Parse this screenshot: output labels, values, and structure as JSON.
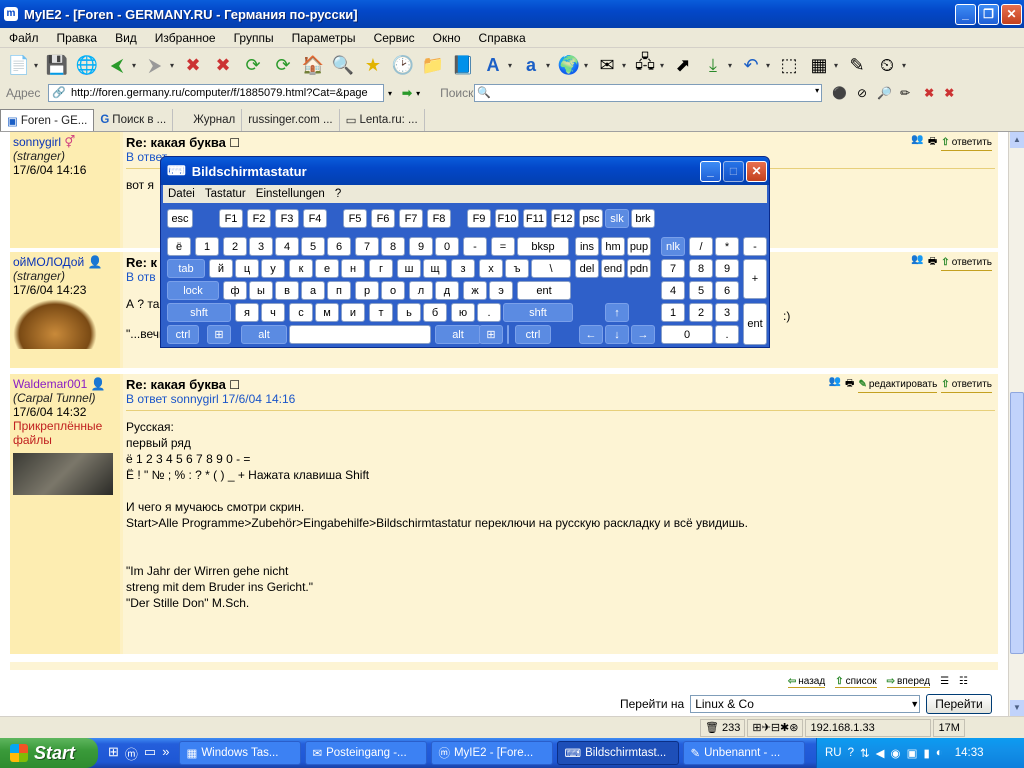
{
  "window": {
    "title": "MyIE2 - [Foren - GERMANY.RU - Германия по-русски]",
    "icon_name": "myie-icon"
  },
  "menu": [
    "Файл",
    "Правка",
    "Вид",
    "Избранное",
    "Группы",
    "Параметры",
    "Сервис",
    "Окно",
    "Справка"
  ],
  "address": {
    "label": "Адрес",
    "url": "http://foren.germany.ru/computer/f/1885079.html?Cat=&page",
    "search_label": "Поиск"
  },
  "tabs": [
    {
      "label": "Foren - GE..."
    },
    {
      "label": "Поиск в ..."
    },
    {
      "label": "Журнал"
    },
    {
      "label": "russinger.com ..."
    },
    {
      "label": "Lenta.ru: ..."
    }
  ],
  "posts": [
    {
      "author": "sonnygirl",
      "rank": "(stranger)",
      "date": "17/6/04 14:16",
      "title": "Re: какая буква",
      "reply_to": "В ответ",
      "text": "вот я"
    },
    {
      "author": "ойМОЛОДой",
      "rank": "(stranger)",
      "date": "17/6/04 14:23",
      "title": "Re: к",
      "reply_to": "В отв",
      "text": "А ? та",
      "text2": "\"...вечно молодой, вечно пьяный...\"",
      "text_side": ":)"
    },
    {
      "author": "Waldemar001",
      "rank": "(Carpal Tunnel)",
      "date": "17/6/04 14:32",
      "attachments": "Прикреплённые файлы",
      "title": "Re: какая буква",
      "reply_to": "В ответ sonnygirl 17/6/04 14:16",
      "text": "Русская:\nпервый ряд\nё 1 2 3 4 5 6 7 8 9 0 - =\nЁ ! \" № ; % : ? * ( ) _ + Нажата клавиша Shift\n\nИ чего я мучаюсь смотри скрин.\nStart>Alle Programme>Zubehör>Eingabehilfe>Bildschirmtastatur переключи на русскую раскладку и всё увидишь.\n\n\n\"Im Jahr der Wirren gehe nicht\nstreng mit dem Bruder ins Gericht.\"\n\"Der Stille Don\" M.Sch."
    }
  ],
  "post_actions": {
    "reply": "ответить",
    "edit": "редактировать"
  },
  "footer_nav": {
    "back": "назад",
    "list": "список",
    "forward": "вперед"
  },
  "goto": {
    "label": "Перейти на",
    "selected": "Linux & Co",
    "button": "Перейти"
  },
  "status": {
    "count": "233",
    "ip": "192.168.1.33",
    "mem": "17M"
  },
  "osk": {
    "title": "Bildschirmtastatur",
    "menu": [
      "Datei",
      "Tastatur",
      "Einstellungen",
      "?"
    ],
    "row_f": [
      "esc",
      "F1",
      "F2",
      "F3",
      "F4",
      "F5",
      "F6",
      "F7",
      "F8",
      "F9",
      "F10",
      "F11",
      "F12",
      "psc",
      "slk",
      "brk"
    ],
    "row_1": [
      "ё",
      "1",
      "2",
      "3",
      "4",
      "5",
      "6",
      "7",
      "8",
      "9",
      "0",
      "-",
      "=",
      "bksp",
      "ins",
      "hm",
      "pup",
      "nlk",
      "/",
      "*",
      "-"
    ],
    "row_2": [
      "tab",
      "й",
      "ц",
      "у",
      "к",
      "е",
      "н",
      "г",
      "ш",
      "щ",
      "з",
      "х",
      "ъ",
      "\\",
      "del",
      "end",
      "pdn",
      "7",
      "8",
      "9",
      "+"
    ],
    "row_3": [
      "lock",
      "ф",
      "ы",
      "в",
      "а",
      "п",
      "р",
      "о",
      "л",
      "д",
      "ж",
      "э",
      "ent",
      "4",
      "5",
      "6"
    ],
    "row_4": [
      "shft",
      "я",
      "ч",
      "с",
      "м",
      "и",
      "т",
      "ь",
      "б",
      "ю",
      ".",
      "shft",
      "↑",
      "1",
      "2",
      "3",
      "ent"
    ],
    "row_5": [
      "ctrl",
      "alt",
      "alt",
      "ctrl",
      "←",
      "↓",
      "→",
      "0",
      "."
    ]
  },
  "taskbar": {
    "start": "Start",
    "items": [
      "Windows Tas...",
      "Posteingang -...",
      "MyIE2 - [Fore...",
      "Bildschirmtast...",
      "Unbenannt - ..."
    ],
    "lang": "RU",
    "time": "14:33"
  }
}
